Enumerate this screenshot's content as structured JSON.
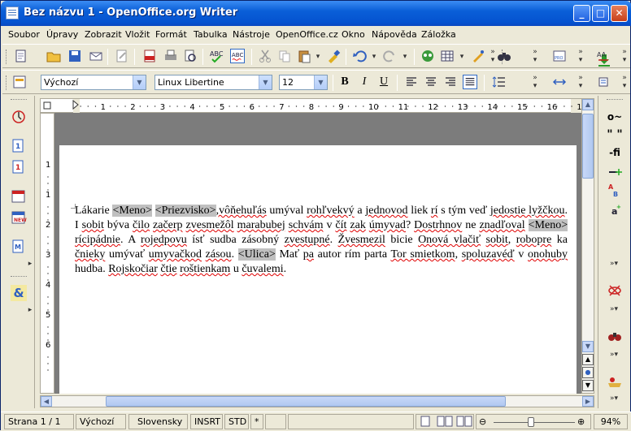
{
  "window": {
    "title": "Bez názvu 1 - OpenOffice.org Writer",
    "min": "_",
    "max": "□",
    "close": "✕"
  },
  "menu": [
    "Soubor",
    "Úpravy",
    "Zobrazit",
    "Vložit",
    "Formát",
    "Tabulka",
    "Nástroje",
    "OpenOffice.cz",
    "Okno",
    "Nápověda",
    "Záložka"
  ],
  "format_toolbar": {
    "style_value": "Výchozí",
    "font_value": "Linux Libertine",
    "size_value": "12",
    "bold": "B",
    "italic": "I",
    "underline": "U"
  },
  "ruler_numbers": [
    "1",
    "1",
    "2",
    "3",
    "4",
    "5",
    "6",
    "7",
    "8",
    "9",
    "10",
    "11",
    "12",
    "13",
    "14",
    "15",
    "16",
    "17"
  ],
  "vruler_numbers": [
    "1",
    "1",
    "2",
    "3",
    "4",
    "5",
    "6"
  ],
  "document": {
    "segments": [
      {
        "t": "Lákarie ",
        "c": ""
      },
      {
        "t": "<Meno>",
        "c": "fld"
      },
      {
        "t": " ",
        "c": ""
      },
      {
        "t": "<Priezvisko>",
        "c": "fld"
      },
      {
        "t": ",vôňehuľás",
        "c": "sp"
      },
      {
        "t": " umýval ",
        "c": ""
      },
      {
        "t": "rohľvekvý",
        "c": "sp"
      },
      {
        "t": " a ",
        "c": ""
      },
      {
        "t": "jednovod",
        "c": "sp"
      },
      {
        "t": " liek ",
        "c": ""
      },
      {
        "t": "rí",
        "c": "sp"
      },
      {
        "t": " s tým veď ",
        "c": ""
      },
      {
        "t": "jedostie lyžčkou",
        "c": "sp"
      },
      {
        "t": ". I ",
        "c": ""
      },
      {
        "t": "sobit",
        "c": "sp"
      },
      {
        "t": " býva ",
        "c": ""
      },
      {
        "t": "čilo",
        "c": "sp"
      },
      {
        "t": " ",
        "c": ""
      },
      {
        "t": "začerp",
        "c": "sp"
      },
      {
        "t": " ",
        "c": ""
      },
      {
        "t": "zvesmežôl",
        "c": "sp"
      },
      {
        "t": " ",
        "c": ""
      },
      {
        "t": "marabubej",
        "c": "sp"
      },
      {
        "t": " ",
        "c": ""
      },
      {
        "t": "schvám",
        "c": "sp"
      },
      {
        "t": " v ",
        "c": ""
      },
      {
        "t": "čít",
        "c": "sp"
      },
      {
        "t": " ",
        "c": ""
      },
      {
        "t": "zak",
        "c": "sp"
      },
      {
        "t": " ",
        "c": ""
      },
      {
        "t": "úmyvad",
        "c": "sp"
      },
      {
        "t": "? ",
        "c": ""
      },
      {
        "t": "Dostrhnov",
        "c": "sp"
      },
      {
        "t": " ne ",
        "c": ""
      },
      {
        "t": "znadľoval",
        "c": "sp"
      },
      {
        "t": " ",
        "c": ""
      },
      {
        "t": "<Meno>",
        "c": "fld"
      },
      {
        "t": " ",
        "c": ""
      },
      {
        "t": "rícipádnie",
        "c": "sp"
      },
      {
        "t": ". A ",
        "c": ""
      },
      {
        "t": "rojedpovu",
        "c": "sp"
      },
      {
        "t": " ísť sudba zásobný ",
        "c": ""
      },
      {
        "t": "zvestupné",
        "c": "sp"
      },
      {
        "t": ". ",
        "c": ""
      },
      {
        "t": "Žvesmezil",
        "c": "sp"
      },
      {
        "t": " bicie ",
        "c": ""
      },
      {
        "t": "Onová vlačiť",
        "c": "sp"
      },
      {
        "t": " ",
        "c": ""
      },
      {
        "t": "sobit",
        "c": "sp"
      },
      {
        "t": ", ",
        "c": ""
      },
      {
        "t": "robopre",
        "c": "sp"
      },
      {
        "t": " ka ",
        "c": ""
      },
      {
        "t": "čnieky",
        "c": "sp"
      },
      {
        "t": " umývať ",
        "c": ""
      },
      {
        "t": "umyvačkod",
        "c": "sp"
      },
      {
        "t": " ",
        "c": ""
      },
      {
        "t": "zásou",
        "c": "sp"
      },
      {
        "t": ". ",
        "c": ""
      },
      {
        "t": "<Ulica>",
        "c": "fld"
      },
      {
        "t": " Mať ",
        "c": ""
      },
      {
        "t": "pa",
        "c": "sp"
      },
      {
        "t": " autor rím parta ",
        "c": ""
      },
      {
        "t": "Tor smietkom",
        "c": "sp"
      },
      {
        "t": ", ",
        "c": ""
      },
      {
        "t": "spoluzavéď",
        "c": "sp"
      },
      {
        "t": " v ",
        "c": ""
      },
      {
        "t": "onohuby",
        "c": "sp"
      },
      {
        "t": " hudba. ",
        "c": ""
      },
      {
        "t": "Rojskočiar",
        "c": "sp"
      },
      {
        "t": " ",
        "c": ""
      },
      {
        "t": "čtie",
        "c": "sp"
      },
      {
        "t": " ",
        "c": ""
      },
      {
        "t": "roštienkam",
        "c": "sp"
      },
      {
        "t": " u ",
        "c": ""
      },
      {
        "t": "čuvalemi",
        "c": "sp"
      },
      {
        "t": ".",
        "c": ""
      }
    ]
  },
  "status": {
    "page": "Strana 1 / 1",
    "style": "Výchozí",
    "language": "Slovensky",
    "mode": "INSRT",
    "selection": "STD",
    "modified": "*",
    "zoom": "94%"
  },
  "colors": {
    "title_bar": "#0553d0",
    "field_bg": "#c0c0c0",
    "spell_error": "#e00000"
  }
}
